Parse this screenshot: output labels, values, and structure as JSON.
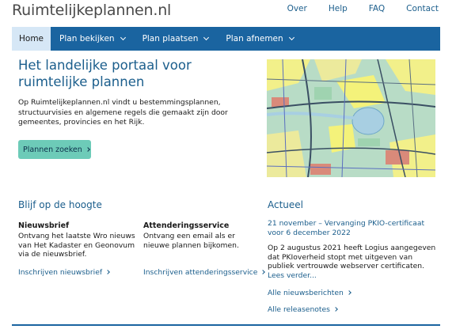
{
  "header": {
    "logo": "Ruimtelijkeplannen.nl",
    "links": [
      "Over",
      "Help",
      "FAQ",
      "Contact"
    ]
  },
  "nav": {
    "items": [
      {
        "label": "Home",
        "active": true,
        "has_menu": false
      },
      {
        "label": "Plan bekijken",
        "active": false,
        "has_menu": true
      },
      {
        "label": "Plan plaatsen",
        "active": false,
        "has_menu": true
      },
      {
        "label": "Plan afnemen",
        "active": false,
        "has_menu": true
      }
    ]
  },
  "hero": {
    "title": "Het landelijke portaal voor ruimtelijke plannen",
    "text": "Op Ruimtelijkeplannen.nl vindt u bestemmingsplannen, structuurvisies en algemene regels die gemaakt zijn door gemeentes, provincies en het Rijk.",
    "button": "Plannen zoeken"
  },
  "blijf": {
    "title": "Blijf op de hoogte",
    "nieuwsbrief": {
      "title": "Nieuwsbrief",
      "text": "Ontvang het laatste Wro nieuws van Het Kadaster en Geonovum via de nieuwsbrief.",
      "link": "Inschrijven nieuwsbrief"
    },
    "attendering": {
      "title": "Attenderingsservice",
      "text": "Ontvang een email als er nieuwe plannen bijkomen.",
      "link": "Inschrijven attenderingsservice"
    }
  },
  "actueel": {
    "title": "Actueel",
    "news_link": "21 november – Vervanging PKIO-certificaat voor 6 december 2022",
    "news_text": "Op 2 augustus 2021 heeft Logius aangegeven dat PKIoverheid stopt met uitgeven van publiek vertrouwde webserver certificaten.",
    "read_more": "Lees verder...",
    "all_news": "Alle nieuwsberichten",
    "all_release": "Alle releasenotes"
  },
  "colors": {
    "nav_bg": "#1a64a0",
    "nav_active_bg": "#d6e7f6",
    "accent_text": "#1b5e8c",
    "button_bg": "#6dcbb8"
  }
}
